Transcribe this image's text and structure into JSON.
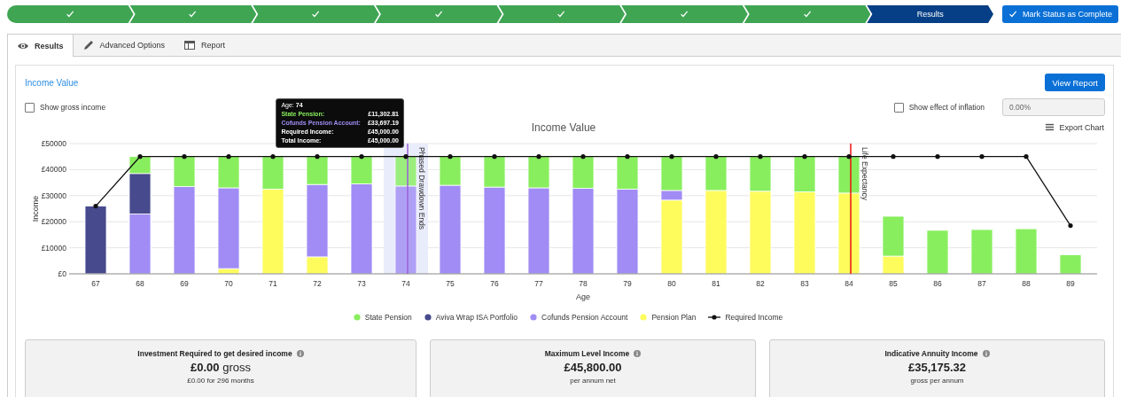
{
  "steps": [
    {
      "complete": true,
      "selected": false
    },
    {
      "complete": true,
      "selected": false
    },
    {
      "complete": true,
      "selected": false
    },
    {
      "complete": true,
      "selected": false
    },
    {
      "complete": true,
      "selected": false
    },
    {
      "complete": true,
      "selected": false
    },
    {
      "complete": true,
      "selected": false
    },
    {
      "label": "Results",
      "complete": false,
      "selected": true
    }
  ],
  "mark_complete_button": "Mark Status as Complete",
  "tabs": [
    {
      "label": "Results",
      "selected": true
    },
    {
      "label": "Advanced Options",
      "selected": false
    },
    {
      "label": "Report",
      "selected": false
    }
  ],
  "card": {
    "title": "Income Value",
    "view_report_button": "View Report",
    "show_gross": {
      "label": "Show gross income",
      "checked": false
    },
    "show_inflation": {
      "label": "Show effect of inflation",
      "checked": false
    },
    "inflation_field": {
      "value": "0.00%",
      "disabled": true
    },
    "export_chart": "Export Chart",
    "chart_data": {
      "type": "bar",
      "stacked": true,
      "title": "Income Value",
      "xlabel": "Age",
      "ylabel": "Income",
      "categories": [
        "67",
        "68",
        "69",
        "70",
        "71",
        "72",
        "73",
        "74",
        "75",
        "76",
        "77",
        "78",
        "79",
        "80",
        "81",
        "82",
        "83",
        "84",
        "85",
        "86",
        "87",
        "88",
        "89"
      ],
      "ylim": [
        0,
        50000
      ],
      "yticks": [
        {
          "value": 0,
          "label": "£0"
        },
        {
          "value": 10000,
          "label": "£10000"
        },
        {
          "value": 20000,
          "label": "£20000"
        },
        {
          "value": 30000,
          "label": "£30000"
        },
        {
          "value": 40000,
          "label": "£40000"
        },
        {
          "value": 50000,
          "label": "£50000"
        }
      ],
      "series": [
        {
          "name": "State Pension",
          "color": "#88ee5e",
          "values": [
            0,
            6500,
            11500,
            12000,
            12500,
            10700,
            10500,
            11300,
            11000,
            11700,
            12000,
            12200,
            12500,
            13000,
            13000,
            13300,
            13500,
            14000,
            15300,
            16700,
            17000,
            17300,
            7300
          ]
        },
        {
          "name": "Aviva Wrap ISA Portfolio",
          "color": "#474a8c",
          "values": [
            26000,
            15500,
            0,
            0,
            0,
            0,
            0,
            0,
            0,
            0,
            0,
            0,
            0,
            0,
            0,
            0,
            0,
            0,
            0,
            0,
            0,
            0,
            0
          ]
        },
        {
          "name": "Cofunds Pension Account",
          "color": "#a08cf4",
          "values": [
            0,
            23000,
            33500,
            31000,
            0,
            27800,
            34500,
            33700,
            34000,
            33300,
            33000,
            32800,
            32500,
            3700,
            0,
            0,
            0,
            0,
            0,
            0,
            0,
            0,
            0
          ]
        },
        {
          "name": "Pension Plan",
          "color": "#fdfc5c",
          "values": [
            0,
            0,
            0,
            2000,
            32500,
            6500,
            0,
            0,
            0,
            0,
            0,
            0,
            0,
            28300,
            32000,
            31700,
            31500,
            31000,
            6800,
            0,
            0,
            0,
            0
          ]
        },
        {
          "name": "Required Income",
          "color": "#111111",
          "type": "line",
          "values": [
            26000,
            45000,
            45000,
            45000,
            45000,
            45000,
            45000,
            45000,
            45000,
            45000,
            45000,
            45000,
            45000,
            45000,
            45000,
            45000,
            45000,
            45000,
            45000,
            45000,
            45000,
            45000,
            18500
          ]
        }
      ],
      "grid": true,
      "ref_lines": [
        {
          "axis": "x",
          "value": "74",
          "label": "Phased Drawdown Ends"
        },
        {
          "axis": "x",
          "value": "84",
          "label": "Life Expectancy"
        }
      ],
      "bands": [
        {
          "axis": "x",
          "from": "74",
          "to": "74"
        }
      ]
    },
    "tooltip": {
      "title": "Age: **74**",
      "rows": [
        {
          "label": "State Pension:",
          "value": "£11,302.81",
          "color": "#88ee5e"
        },
        {
          "label": "Cofunds Pension Account:",
          "value": "£33,697.19",
          "color": "#a08cf4"
        },
        {
          "label": "Required Income:",
          "value": "£45,000.00",
          "color": "#ffffff"
        },
        {
          "label": "Total Income:",
          "value": "£45,000.00",
          "color": "#ffffff"
        }
      ]
    }
  },
  "summaries": [
    {
      "title": "Investment Required to get desired income",
      "value": "**£0.00** gross",
      "note": "£0.00 for 296 months"
    },
    {
      "title": "Maximum Level Income",
      "value": "**£45,800.00**",
      "note": "per annum net"
    },
    {
      "title": "Indicative Annuity Income",
      "value": "**£35,175.32**",
      "note": "gross per annum"
    }
  ]
}
